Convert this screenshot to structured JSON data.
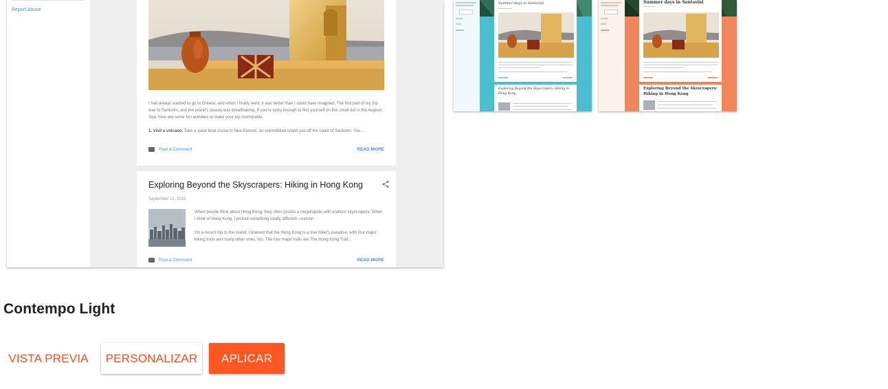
{
  "main_preview": {
    "sidebar": {
      "report_abuse": "Report Abuse"
    },
    "post1": {
      "paragraph1": "I had always wanted to go to Greece, and when I finally went, it was better than I could have imagined. The first part of my trip was to Santorini, and the island's beauty was breathtaking. If you're lucky enough to find yourself on this small dot in the Aegean Sea, here are some fun activities to make your trip memorable.",
      "item_number": "1. Visit a volcano.",
      "item_text": "Take a quick boat cruise to Nea Kameni, an uninhabited island just off the coast of Santorini. You ...",
      "comment_link": "Post a Comment",
      "read_more": "READ MORE"
    },
    "post2": {
      "title": "Exploring Beyond the Skyscrapers: Hiking in Hong Kong",
      "date": "September 12, 2016",
      "paragraph1": "When people think about Hong Kong, they often picture a megalopolis with endless skyscrapers. When I think of Hong Kong, I picture something totally different—nature!",
      "paragraph2": "On a recent trip to the island, I learned that the Hong Kong is a true hiker's paradise, with four major hiking trails and many other ones, too. The four major trails are The Hong Kong Trail...",
      "comment_link": "Post a Comment",
      "read_more": "READ MORE"
    }
  },
  "thumbnails": [
    {
      "variant": "teal",
      "post1_title": "Summer days in Santorini",
      "post2_title": "Exploring Beyond the Skyscrapers: Hiking in Hong Kong"
    },
    {
      "variant": "coral",
      "post1_title": "Summer days in Santorini",
      "post2_title": "Exploring Beyond the Skyscrapers: Hiking in Hong Kong"
    }
  ],
  "theme": {
    "name": "Contempo Light",
    "buttons": {
      "preview": "VISTA PREVIA",
      "customize": "PERSONALIZAR",
      "apply": "APLICAR"
    }
  },
  "colors": {
    "accent": "#ff5722",
    "accent_text": "#f4511e",
    "link": "#4a90c8",
    "teal_bg": "#4dbed0",
    "coral_bg": "#f0845a"
  }
}
